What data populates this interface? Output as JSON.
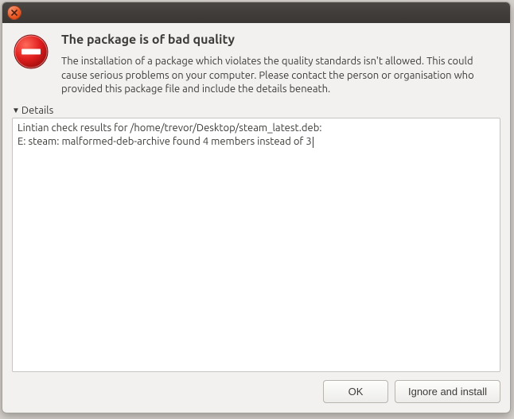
{
  "dialog": {
    "title": "The package is of bad quality",
    "message": "The installation of a package which violates the quality standards isn't allowed. This could cause serious problems on your computer. Please contact the person or organisation who provided this package file and include the details beneath."
  },
  "details": {
    "label": "Details",
    "line1": "Lintian check results for /home/trevor/Desktop/steam_latest.deb:",
    "line2": "E: steam: malformed-deb-archive found 4 members instead of 3"
  },
  "buttons": {
    "ok": "OK",
    "ignore": "Ignore and install"
  }
}
